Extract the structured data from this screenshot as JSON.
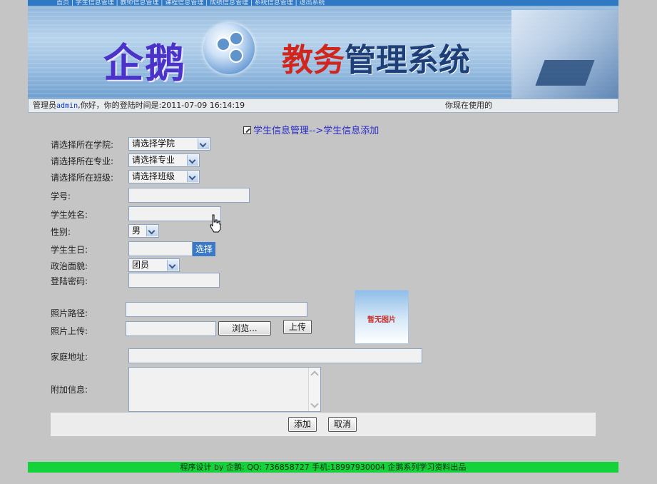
{
  "header": {
    "logo_left": "企鹅",
    "logo_right_red": "教务",
    "logo_right_blue": "管理系统",
    "nav_text": "首页 | 学生信息管理 | 教师信息管理 | 课程信息管理 | 成绩信息管理 | 系统信息管理 | 退出系统"
  },
  "statusbar": {
    "prefix": "管理员",
    "user": "admin",
    "greeting": ",你好，你的登陆时间是:2011-07-09 16:14:19",
    "right_text": "你现在使用的"
  },
  "page": {
    "title": "学生信息管理-->学生信息添加"
  },
  "form": {
    "college_label": "请选择所在学院:",
    "college_value": "请选择学院",
    "major_label": "请选择所在专业:",
    "major_value": "请选择专业",
    "class_label": "请选择所在班级:",
    "class_value": "请选择班级",
    "student_id_label": "学号:",
    "student_name_label": "学生姓名:",
    "gender_label": "性别:",
    "gender_value": "男",
    "birthday_label": "学生生日:",
    "pick_button": "选择",
    "political_label": "政治面貌:",
    "political_value": "团员",
    "password_label": "登陆密码:",
    "photo_path_label": "照片路径:",
    "photo_upload_label": "照片上传:",
    "browse_button": "浏览...",
    "upload_button": "上传",
    "photo_placeholder": "暂无图片",
    "address_label": "家庭地址:",
    "extra_label": "附加信息:",
    "add_button": "添加",
    "cancel_button": "取消"
  },
  "footer": {
    "text": "程序设计 by 企鹅; QQ: 736858727 手机:18997930004 企鹅系列学习资料出品"
  }
}
